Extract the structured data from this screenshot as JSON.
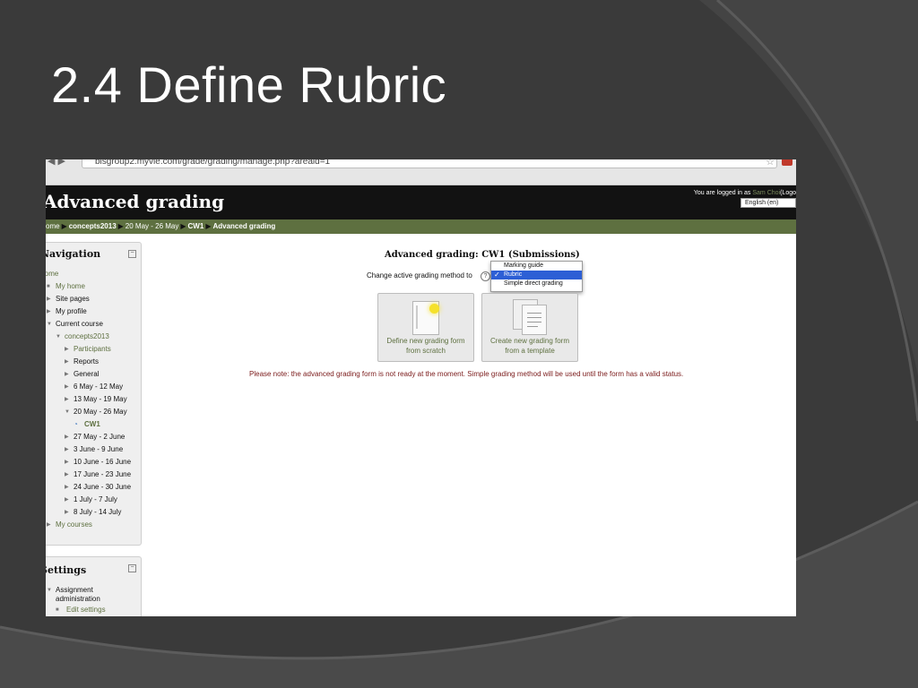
{
  "slide": {
    "title": "2.4 Define Rubric"
  },
  "browser": {
    "url": "bisgroup2.myvle.com/grade/grading/manage.php?areaid=1"
  },
  "site": {
    "title": "Advanced grading",
    "login_prefix": "You are logged in as",
    "user_name": "Sam Choi",
    "logout_fragment": "(Logo",
    "language": "English (en)"
  },
  "breadcrumb": [
    "ome",
    "concepts2013",
    "20 May - 26 May",
    "CW1",
    "Advanced grading"
  ],
  "navigation": {
    "title": "Navigation",
    "collapse": "−",
    "items": [
      {
        "label": "Home"
      },
      {
        "label": "My home"
      },
      {
        "label": "Site pages"
      },
      {
        "label": "My profile"
      },
      {
        "label": "Current course"
      },
      {
        "label": "concepts2013"
      },
      {
        "label": "Participants"
      },
      {
        "label": "Reports"
      },
      {
        "label": "General"
      },
      {
        "label": "6 May - 12 May"
      },
      {
        "label": "13 May - 19 May"
      },
      {
        "label": "20 May - 26 May"
      },
      {
        "label": "CW1"
      },
      {
        "label": "27 May - 2 June"
      },
      {
        "label": "3 June - 9 June"
      },
      {
        "label": "10 June - 16 June"
      },
      {
        "label": "17 June - 23 June"
      },
      {
        "label": "24 June - 30 June"
      },
      {
        "label": "1 July - 7 July"
      },
      {
        "label": "8 July - 14 July"
      },
      {
        "label": "My courses"
      }
    ]
  },
  "settings": {
    "title": "Settings",
    "collapse": "−",
    "items": [
      {
        "label": "Assignment"
      },
      {
        "label": "administration"
      },
      {
        "label": "Edit settings"
      }
    ]
  },
  "main": {
    "title": "Advanced grading: CW1 (Submissions)",
    "change_label": "Change active grading method to",
    "help": "?",
    "options": [
      "Marking guide",
      "Rubric",
      "Simple direct grading"
    ],
    "selected_option": "Rubric",
    "check": "✓",
    "tile_scratch": [
      "Define new grading form",
      "from scratch"
    ],
    "tile_template": [
      "Create new grading form",
      "from a template"
    ],
    "note": "Please note: the advanced grading form is not ready at the moment. Simple grading method will be used until the form has a valid status."
  },
  "colors": {
    "slide_bg": "#3a3a3a",
    "moodle_green": "#5e7040",
    "header_black": "#121212",
    "selected_blue": "#2d5fd5"
  }
}
